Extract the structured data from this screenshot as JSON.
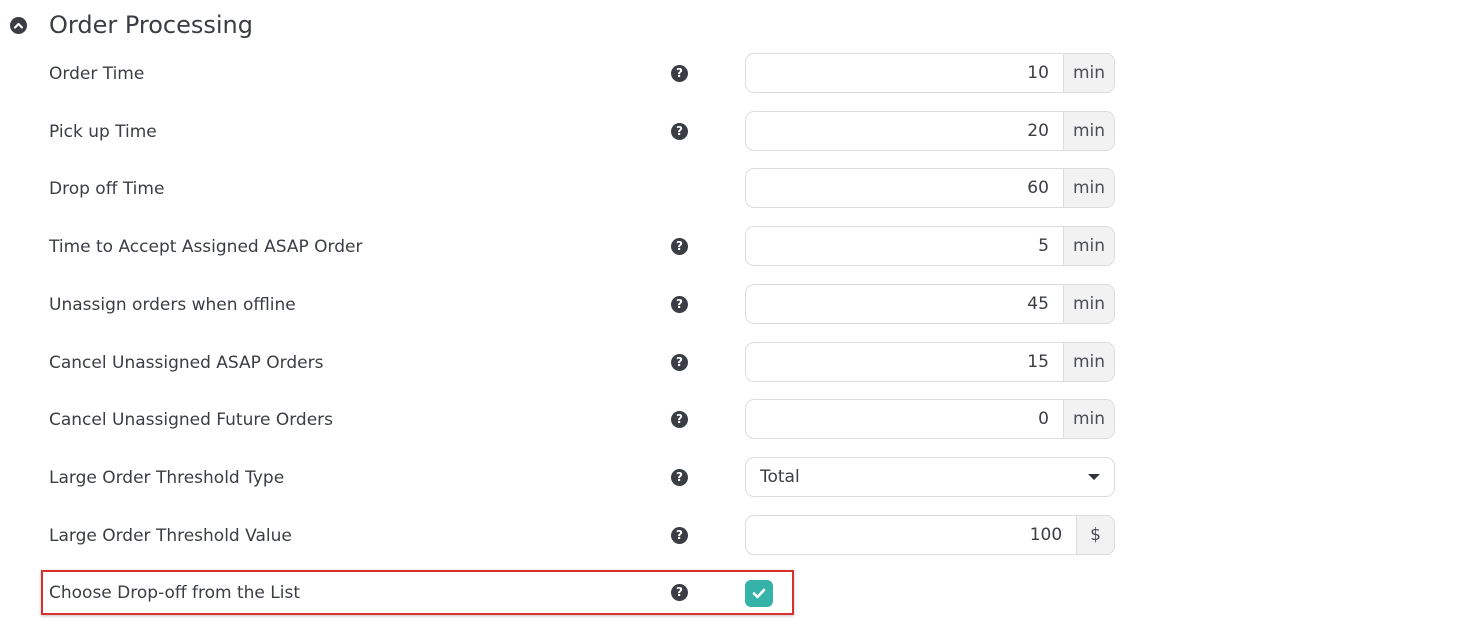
{
  "section": {
    "title": "Order Processing",
    "collapse_icon": "chevron-up-circle-icon"
  },
  "fields": [
    {
      "label": "Order Time",
      "value": "10",
      "unit": "min",
      "help": true
    },
    {
      "label": "Pick up Time",
      "value": "20",
      "unit": "min",
      "help": true
    },
    {
      "label": "Drop off Time",
      "value": "60",
      "unit": "min",
      "help": false
    },
    {
      "label": "Time to Accept Assigned ASAP Order",
      "value": "5",
      "unit": "min",
      "help": true
    },
    {
      "label": "Unassign orders when offline",
      "value": "45",
      "unit": "min",
      "help": true
    },
    {
      "label": "Cancel Unassigned ASAP Orders",
      "value": "15",
      "unit": "min",
      "help": true
    },
    {
      "label": "Cancel Unassigned Future Orders",
      "value": "0",
      "unit": "min",
      "help": true
    }
  ],
  "threshold_type": {
    "label": "Large Order Threshold Type",
    "selected": "Total"
  },
  "threshold_value": {
    "label": "Large Order Threshold Value",
    "value": "100",
    "unit": "$"
  },
  "dropoff_list": {
    "label": "Choose Drop-off from the List",
    "checked": true
  },
  "help_glyph": "?",
  "colors": {
    "text": "#3a3d44",
    "checkbox": "#35b3a8",
    "highlight": "#d9302d",
    "addon_bg": "#f2f2f2",
    "border": "#dcdcdc"
  }
}
